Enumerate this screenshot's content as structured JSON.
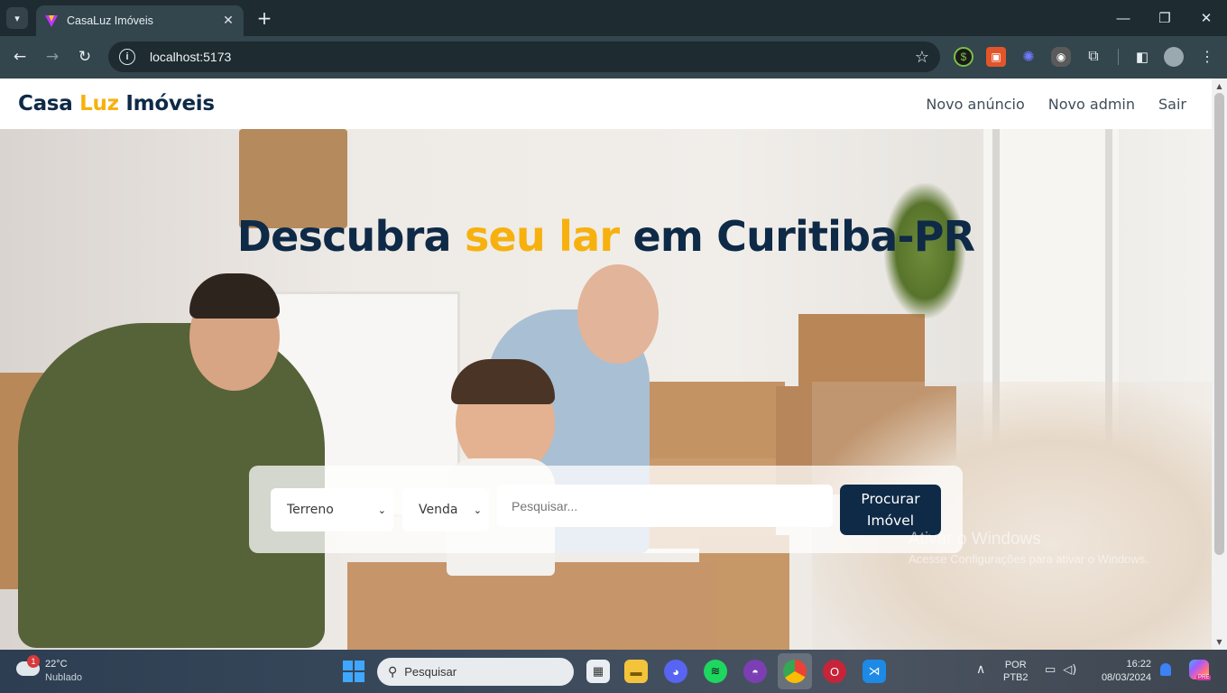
{
  "browser": {
    "tab_title": "CasaLuz Imóveis",
    "url": "localhost:5173",
    "new_tab_symbol": "+",
    "tab_close_symbol": "✕",
    "window_controls": {
      "minimize": "—",
      "restore": "❐",
      "close": "✕"
    }
  },
  "site": {
    "logo": {
      "part1": "Casa",
      "accent": "Luz",
      "part2": "Imóveis"
    },
    "nav": [
      {
        "label": "Novo anúncio"
      },
      {
        "label": "Novo admin"
      },
      {
        "label": "Sair"
      }
    ],
    "hero": {
      "title_part1": "Descubra",
      "title_accent": "seu lar",
      "title_part2": "em Curitiba-PR"
    },
    "search": {
      "type_select": "Terreno",
      "deal_select": "Venda",
      "input_placeholder": "Pesquisar...",
      "button_line1": "Procurar",
      "button_line2": "Imóvel"
    }
  },
  "windows_watermark": {
    "title": "Ativar o Windows",
    "subtitle": "Acesse Configurações para ativar o Windows."
  },
  "taskbar": {
    "weather_temp": "22°C",
    "weather_condition": "Nublado",
    "weather_badge": "1",
    "search_label": "Pesquisar",
    "lang_line1": "POR",
    "lang_line2": "PTB2",
    "time": "16:22",
    "date": "08/03/2024",
    "copilot_badge": "PRE"
  },
  "colors": {
    "brand_navy": "#0e2a47",
    "brand_yellow": "#f7b10e",
    "chrome_dark": "#1e2b31",
    "chrome_mid": "#33454d"
  }
}
